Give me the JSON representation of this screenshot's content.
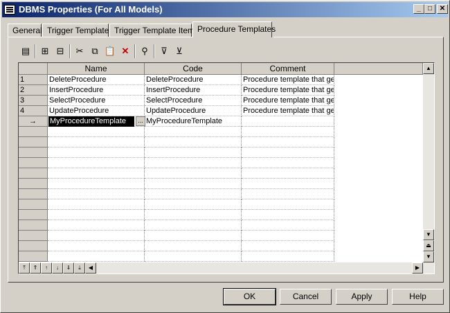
{
  "window": {
    "title": "DBMS Properties (For All Models)"
  },
  "titlebar_buttons": {
    "minimize": "_",
    "maximize": "□",
    "close": "✕"
  },
  "tabs": [
    {
      "label": "General"
    },
    {
      "label": "Trigger Templates"
    },
    {
      "label": "Trigger Template Items"
    },
    {
      "label": "Procedure Templates",
      "active": true
    }
  ],
  "toolbar": {
    "items": [
      "properties-icon",
      "insert-row-icon",
      "add-row-icon",
      "cut-icon",
      "copy-icon",
      "paste-icon",
      "delete-icon",
      "find-icon",
      "filter-icon",
      "clear-filter-icon"
    ]
  },
  "grid": {
    "columns": [
      "Name",
      "Code",
      "Comment"
    ],
    "rows": [
      {
        "num": "1",
        "name": "DeleteProcedure",
        "code": "DeleteProcedure",
        "comment": "Procedure template that ge"
      },
      {
        "num": "2",
        "name": "InsertProcedure",
        "code": "InsertProcedure",
        "comment": "Procedure template that ge"
      },
      {
        "num": "3",
        "name": "SelectProcedure",
        "code": "SelectProcedure",
        "comment": "Procedure template that ge"
      },
      {
        "num": "4",
        "name": "UpdateProcedure",
        "code": "UpdateProcedure",
        "comment": "Procedure template that ge"
      },
      {
        "num": "→",
        "name": "MyProcedureTemplate",
        "code": "MyProcedureTemplate",
        "comment": "",
        "editing": true
      }
    ],
    "edit_button": "..."
  },
  "buttons": {
    "ok": "OK",
    "cancel": "Cancel",
    "apply": "Apply",
    "help": "Help"
  }
}
